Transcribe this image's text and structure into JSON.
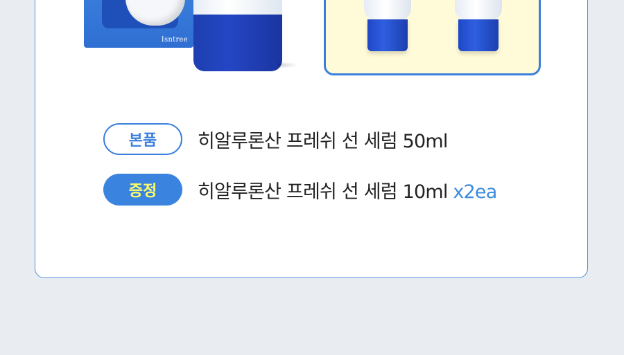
{
  "brand": "Isntree",
  "items": [
    {
      "badge": "본품",
      "name": "히알루론산 프레쉬 선 세럼 50ml",
      "qty": ""
    },
    {
      "badge": "증정",
      "name": "히알루론산 프레쉬 선 세럼 10ml",
      "qty": "x2ea"
    }
  ],
  "colors": {
    "accent": "#3a7fdc",
    "gift_badge_bg": "#3a84e0",
    "gift_badge_text": "#ffff66",
    "gift_panel_bg": "#fffbd9",
    "page_bg": "#e9ecf1"
  }
}
